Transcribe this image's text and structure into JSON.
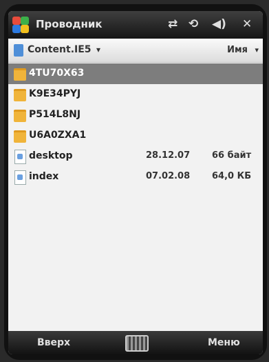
{
  "title_bar": {
    "app_title": "Проводник",
    "icons": [
      "connectivity-icon",
      "sync-icon",
      "volume-icon",
      "close-icon"
    ],
    "close_label": "✕"
  },
  "folder_bar": {
    "folder_name": "Content.IE5",
    "caret": "▾",
    "sort_label": "Имя",
    "sort_caret": "▾"
  },
  "files": [
    {
      "name": "4TU70X63",
      "type": "folder",
      "date": "",
      "size": "",
      "selected": true
    },
    {
      "name": "K9E34PYJ",
      "type": "folder",
      "date": "",
      "size": "",
      "selected": false
    },
    {
      "name": "P514L8NJ",
      "type": "folder",
      "date": "",
      "size": "",
      "selected": false
    },
    {
      "name": "U6A0ZXA1",
      "type": "folder",
      "date": "",
      "size": "",
      "selected": false
    },
    {
      "name": "desktop",
      "type": "file",
      "date": "28.12.07",
      "size": "66 байт",
      "selected": false
    },
    {
      "name": "index",
      "type": "file",
      "date": "07.02.08",
      "size": "64,0 КБ",
      "selected": false
    }
  ],
  "bottom_bar": {
    "left_softkey": "Вверх",
    "right_softkey": "Меню"
  }
}
